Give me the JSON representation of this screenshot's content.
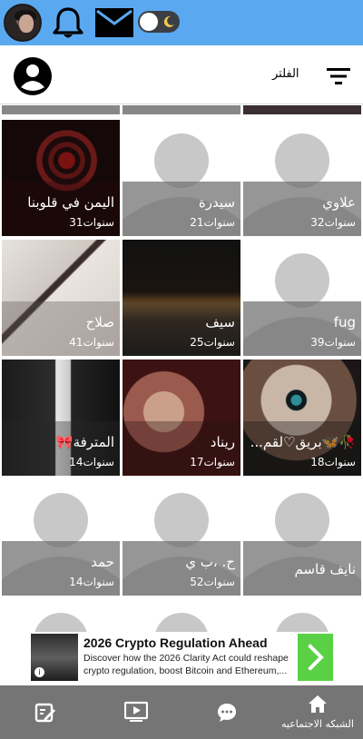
{
  "topbar": {
    "icons": [
      "avatar",
      "bell-icon",
      "mail-icon",
      "dark-mode-toggle",
      "moon-icon"
    ]
  },
  "header": {
    "filter_label": "الفلتر",
    "icons": [
      "profile-icon",
      "filter-icon"
    ]
  },
  "cards": [
    {
      "name": "اليمن في قلوبنا",
      "age": "31سنوات",
      "photo": "red-spiral"
    },
    {
      "name": "سيدرة",
      "age": "21سنوات",
      "photo": "default-silhouette"
    },
    {
      "name": "علاوي",
      "age": "32سنوات",
      "photo": "default-silhouette"
    },
    {
      "name": "صلاح",
      "age": "41سنوات",
      "photo": "phone-cases"
    },
    {
      "name": "سيف",
      "age": "25سنوات",
      "photo": "night-city"
    },
    {
      "name": "fug",
      "age": "39سنوات",
      "photo": "default-silhouette"
    },
    {
      "name": "المترفة🎀",
      "age": "14سنوات",
      "photo": "niqab-selfie"
    },
    {
      "name": "ريناد",
      "age": "17سنوات",
      "photo": "woman-face"
    },
    {
      "name": "🥀🦋بريق♡لقم...",
      "age": "18سنوات",
      "photo": "eye-closeup"
    },
    {
      "name": "حمد",
      "age": "14سنوات",
      "photo": "default-silhouette"
    },
    {
      "name": "ح. ،ب ي",
      "age": "52سنوات",
      "photo": "default-silhouette"
    },
    {
      "name": "نايف قاسم",
      "age": "",
      "photo": "default-silhouette"
    }
  ],
  "ad": {
    "title": "2026 Crypto Regulation Ahead",
    "description": "Discover how the 2026 Clarity Act could reshape crypto regulation, boost Bitcoin and Ethereum,..."
  },
  "bottom_nav": {
    "items": [
      {
        "icon": "edit-icon",
        "label": ""
      },
      {
        "icon": "video-icon",
        "label": ""
      },
      {
        "icon": "chat-icon",
        "label": ""
      },
      {
        "icon": "home-icon",
        "label": "الشبكه الاجتماعيه"
      }
    ]
  },
  "colors": {
    "topbar": "#5aa9f0",
    "bottom_nav": "#757575",
    "card_overlay": "#6e6e6e",
    "ad_cta": "#5ad145"
  }
}
